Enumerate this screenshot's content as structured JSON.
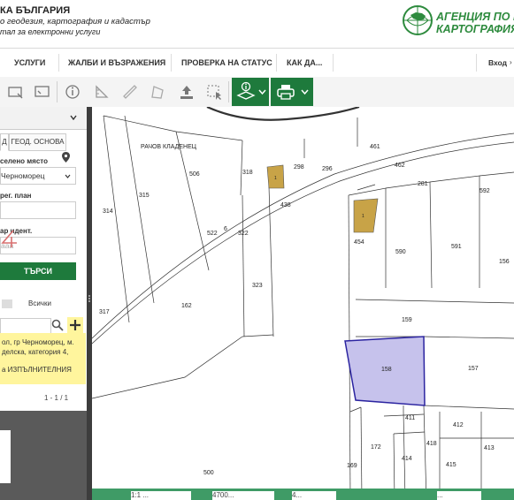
{
  "header": {
    "title": "КА БЪЛГАРИЯ",
    "subtitle": "о геодезия, картография и кадастър",
    "portal": "тал за електронни услуги",
    "agency_line1": "АГЕНЦИЯ ПО Г",
    "agency_line2": "КАРТОГРАФИЯ"
  },
  "nav": {
    "items": [
      "УСЛУГИ",
      "ЖАЛБИ И ВЪЗРАЖЕНИЯ",
      "ПРОВЕРКА НА СТАТУС",
      "КАК ДА..."
    ],
    "login": "Вход"
  },
  "sidebar": {
    "tabs": [
      "Д",
      "ГЕОД. ОСНОВА"
    ],
    "settlement_label": "селено място",
    "settlement_value": "Черноморец",
    "plan_label": "рег. план",
    "ident_label": "ар идент.",
    "ident_value": "ааа",
    "search_label": "ТЪРСИ",
    "all_label": "Всички",
    "result_line1": "ол, гр Черноморец, м.",
    "result_line2": "делска, категория 4,",
    "result_line3": "",
    "result_line4": "а ИЗПЪЛНИТЕЛНИЯ",
    "pagination": "1 - 1 / 1"
  },
  "map": {
    "locality": "РАЧОВ КЛАДЕНЕЦ",
    "parcels": [
      "506",
      "315",
      "314",
      "318",
      "298",
      "296",
      "461",
      "462",
      "281",
      "592",
      "438",
      "522",
      "6",
      "322",
      "454",
      "590",
      "591",
      "156",
      "323",
      "317",
      "162",
      "159",
      "158",
      "157",
      "411",
      "412",
      "172",
      "414",
      "418",
      "415",
      "413",
      "169",
      "500",
      "1",
      "1"
    ]
  },
  "bottom_bar": {
    "fields": [
      "1:1 ...",
      "4700...",
      "4...",
      "..."
    ]
  }
}
